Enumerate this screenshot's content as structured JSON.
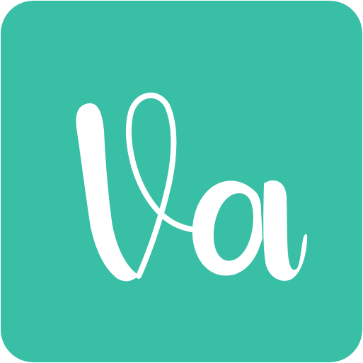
{
  "app_icon": {
    "logo_text": "Va",
    "background_color": "#38BFA5",
    "glyph_color": "#FFFFFF",
    "icon_name": "va-script-logo-icon"
  }
}
